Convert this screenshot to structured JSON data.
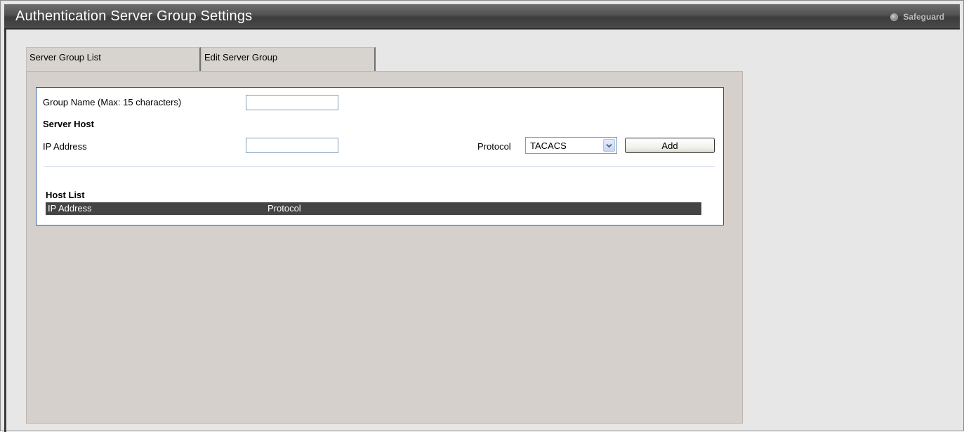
{
  "window": {
    "title": "Authentication Server Group Settings",
    "safeguard_label": "Safeguard"
  },
  "tabs": [
    {
      "label": "Server Group List",
      "active": false
    },
    {
      "label": "Edit Server Group",
      "active": true
    }
  ],
  "form": {
    "group_name_label": "Group Name  (Max: 15 characters)",
    "group_name_value": "",
    "server_host_heading": "Server Host",
    "ip_address_label": "IP Address",
    "ip_address_value": "",
    "protocol_label": "Protocol",
    "protocol_selected": "TACACS",
    "add_button_label": "Add"
  },
  "host_list": {
    "heading": "Host List",
    "columns": [
      "IP Address",
      "Protocol"
    ],
    "rows": []
  },
  "colors": {
    "titlebar": "#4a4a4a",
    "panel_bg": "#d5d0cb",
    "form_border": "#2f5b9a",
    "table_header_bg": "#444444"
  }
}
